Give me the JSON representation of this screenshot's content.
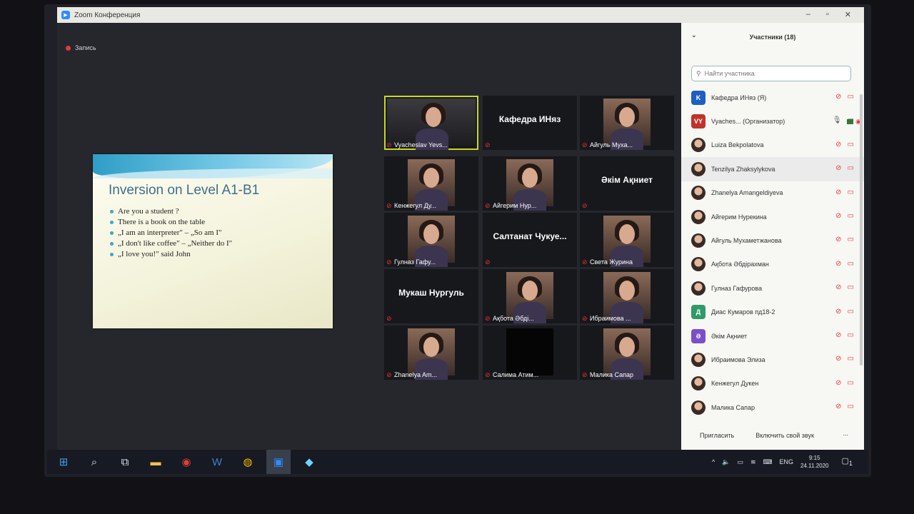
{
  "window": {
    "title": "Zoom Конференция",
    "recording_label": "Запись"
  },
  "slide": {
    "title": "Inversion on Level A1-B1",
    "lines": [
      "Are you a student ?",
      "There is a book on the table",
      "„I am an interpreter\" – „So am I\"",
      "„I don't like coffee\" – „Neither do I\"",
      "„I love you!\" said John"
    ]
  },
  "gallery": [
    {
      "name": "Vyacheslav Yevs...",
      "type": "video",
      "active": true
    },
    {
      "name": "Кафедра ИНяз",
      "type": "name-only"
    },
    {
      "name": "Айгуль Муха...",
      "type": "video"
    },
    {
      "name": "Кенжегул Ду...",
      "type": "video"
    },
    {
      "name": "Айгерим Нур...",
      "type": "video"
    },
    {
      "name": "Әкім Ақниет",
      "type": "name-only"
    },
    {
      "name": "Гулназ Гафу...",
      "type": "video"
    },
    {
      "name": "Салтанат Чукуе...",
      "type": "name-only"
    },
    {
      "name": "Света Журина",
      "type": "video"
    },
    {
      "name": "Мукаш Нургуль",
      "type": "name-only"
    },
    {
      "name": "Ақбота Әбді...",
      "type": "video"
    },
    {
      "name": "Ибраимова ...",
      "type": "video"
    },
    {
      "name": "Zhanelya Am...",
      "type": "video"
    },
    {
      "name": "Салима Атим...",
      "type": "dark"
    },
    {
      "name": "Малика Сапар",
      "type": "video"
    }
  ],
  "participants_panel": {
    "title": "Участники (18)",
    "search_placeholder": "Найти участника",
    "participants": [
      {
        "name": "Кафедра ИНяз (Я)",
        "avatar": "K",
        "color": "#1f5fbf"
      },
      {
        "name": "Vyaches... (Организатор)",
        "avatar": "VY",
        "color": "#c0332b",
        "host": true
      },
      {
        "name": "Luiza Bekpolatova",
        "avatar": "photo"
      },
      {
        "name": "Tenzilya Zhaksylykova",
        "avatar": "photo",
        "highlight": true
      },
      {
        "name": "Zhanelya Amangeldiyeva",
        "avatar": "photo"
      },
      {
        "name": "Айгерим Нурекина",
        "avatar": "photo"
      },
      {
        "name": "Айгуль Мухаметжанова",
        "avatar": "photo"
      },
      {
        "name": "Ақбота Әбдірахман",
        "avatar": "photo"
      },
      {
        "name": "Гулназ Гафурова",
        "avatar": "photo"
      },
      {
        "name": "Диас Кумаров пд18-2",
        "avatar": "Д",
        "color": "#2f9a6a"
      },
      {
        "name": "Әкім Ақниет",
        "avatar": "Ә",
        "color": "#7b4fc9"
      },
      {
        "name": "Ибраимова Элиза",
        "avatar": "photo"
      },
      {
        "name": "Кенжегул Дукен",
        "avatar": "photo"
      },
      {
        "name": "Малика Сапар",
        "avatar": "photo"
      }
    ],
    "invite_label": "Пригласить",
    "unmute_label": "Включить свой звук",
    "more_label": "..."
  },
  "taskbar": {
    "language": "ENG",
    "time": "9:15",
    "date": "24.11.2020",
    "notifications": "1"
  },
  "colors": {
    "active_speaker": "#c9d91c",
    "muted": "#e23b3b",
    "zoom_blue": "#2d8cff"
  }
}
